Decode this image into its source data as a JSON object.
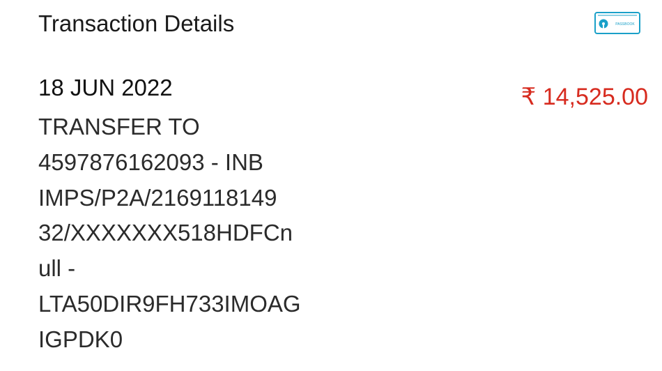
{
  "header": {
    "title": "Transaction Details",
    "passbook_icon": {
      "name": "passbook-icon",
      "label": "PASSBOOK",
      "color": "#1aa0c8"
    }
  },
  "transaction": {
    "date": "18 JUN 2022",
    "amount": "₹ 14,525.00",
    "amount_color": "#d72b1f",
    "description_lines": [
      "TRANSFER TO",
      "4597876162093 - INB",
      "IMPS/P2A/2169118149",
      "32/XXXXXXX518HDFCn",
      "ull -",
      "LTA50DIR9FH733IMOAG",
      "IGPDK0"
    ]
  }
}
